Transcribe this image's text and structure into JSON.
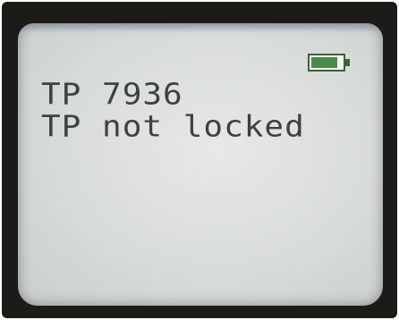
{
  "screen": {
    "lines": [
      "TP 7936",
      "TP not locked"
    ],
    "battery": {
      "icon": "battery-icon",
      "level": 0.85,
      "fill_color": "#4c8a4a"
    },
    "colors": {
      "lcd_background": "#d8dcd9",
      "text": "#3d4240",
      "bezel": "#1d1b18"
    }
  }
}
